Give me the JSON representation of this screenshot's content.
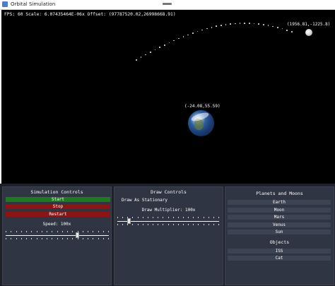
{
  "window": {
    "title": "Orbital Simulation"
  },
  "viewport": {
    "stats": "FPS: 60  Scale: 6.07435464E-06x  Offset: (97787520.02,26998668.91)",
    "earth_label": "(-24.08,55.59)",
    "moon_label": "(1956.81,-1225.8)"
  },
  "simulation_controls": {
    "title": "Simulation Controls",
    "start_label": "Start",
    "stop_label": "Stop",
    "restart_label": "Restart",
    "speed_label": "Speed: 100x",
    "speed_fraction": 0.7
  },
  "draw_controls": {
    "title": "Draw Controls",
    "mode_label": "Draw As Stationary",
    "multiplier_label": "Draw Multiplier: 100x",
    "multiplier_fraction": 0.1
  },
  "planets_panel": {
    "title": "Planets and Moons",
    "planets": [
      "Earth",
      "Moon",
      "Mars",
      "Venus",
      "Sun"
    ],
    "objects_title": "Objects",
    "objects": [
      "ISS",
      "Cat"
    ]
  },
  "colors": {
    "start": "#1f7a1f",
    "stop": "#8e1414",
    "panel_bg": "#2f3542",
    "viewport_bg": "#000000"
  }
}
